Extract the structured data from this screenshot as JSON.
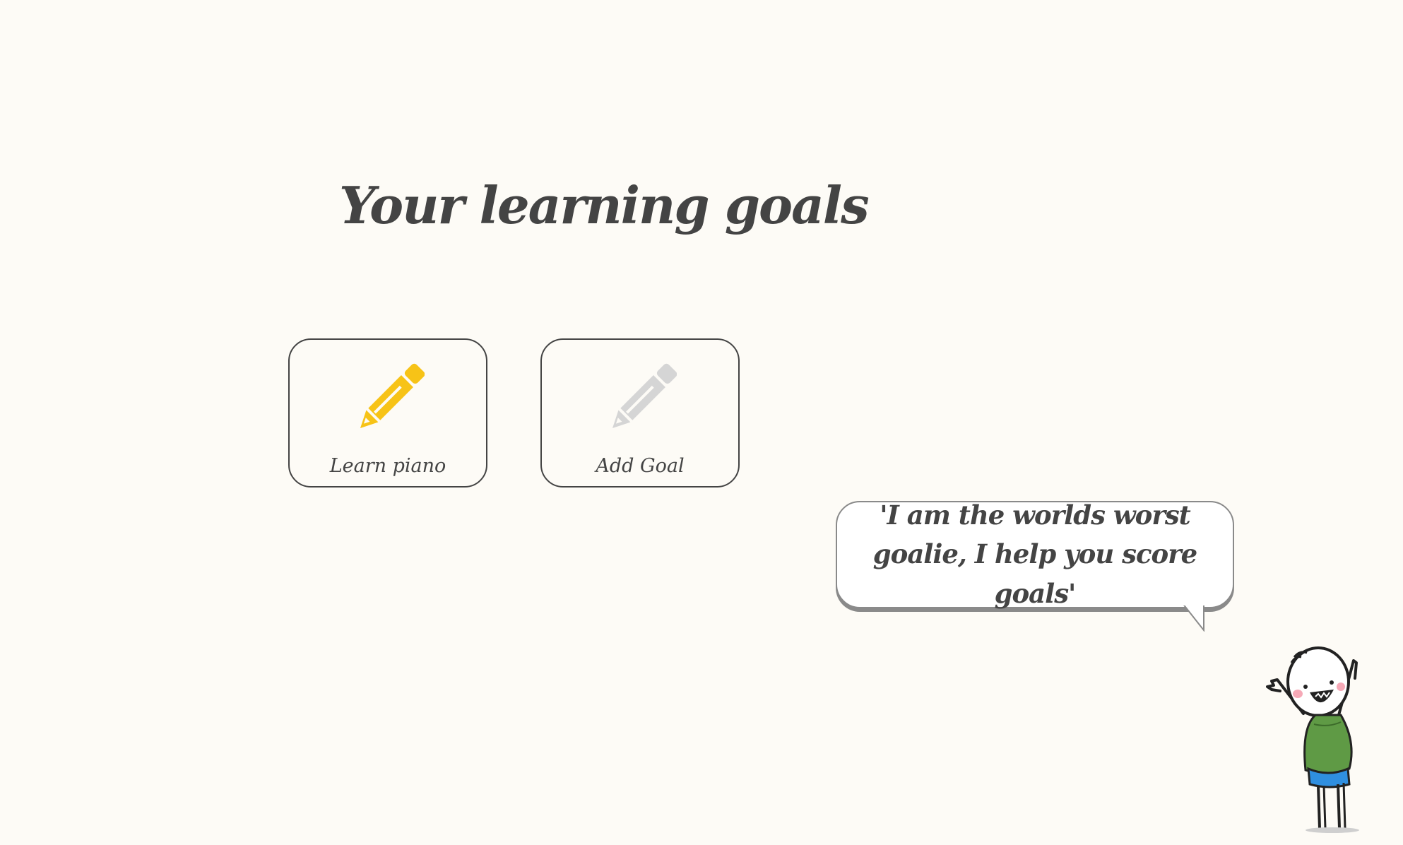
{
  "page": {
    "title": "Your learning goals"
  },
  "goals": [
    {
      "label": "Learn piano",
      "icon": "pencil-icon",
      "color": "#f7c317"
    },
    {
      "label": "Add Goal",
      "icon": "pencil-icon",
      "color": "#d5d5d5"
    }
  ],
  "mascot": {
    "quote": "'I am the worlds worst goalie, I help you score goals'",
    "shirt_color": "#5f9a45",
    "shorts_color": "#2f8fe0"
  }
}
